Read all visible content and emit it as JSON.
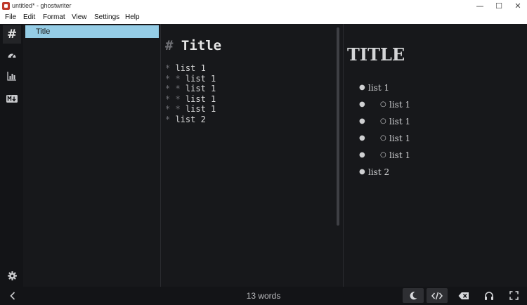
{
  "window": {
    "title": "untitled* - ghostwriter",
    "controls": {
      "minimize": "—",
      "maximize": "☐",
      "close": "✕"
    }
  },
  "menu": [
    "File",
    "Edit",
    "Format",
    "View",
    "Settings",
    "Help"
  ],
  "sidebar": {
    "icons": [
      "hash-icon",
      "speedometer-icon",
      "bar-chart-icon",
      "markdown-icon"
    ],
    "settings_icon": "gear-icon",
    "hash_glyph": "#"
  },
  "outline": {
    "items": [
      "Title"
    ]
  },
  "editor": {
    "heading_mark": "#",
    "heading_text": "Title",
    "lines": [
      {
        "marks": "* ",
        "text": "list 1"
      },
      {
        "marks": "* * ",
        "text": "list 1"
      },
      {
        "marks": "* * ",
        "text": "list 1"
      },
      {
        "marks": "* * ",
        "text": "list 1"
      },
      {
        "marks": "* * ",
        "text": "list 1"
      },
      {
        "marks": "* ",
        "text": "list 2"
      }
    ]
  },
  "preview": {
    "title": "TITLE",
    "items": [
      {
        "text": "list 1",
        "level": 1
      },
      {
        "text": "list 1",
        "level": 2
      },
      {
        "text": "list 1",
        "level": 2
      },
      {
        "text": "list 1",
        "level": 2
      },
      {
        "text": "list 1",
        "level": 2
      },
      {
        "text": "list 2",
        "level": 1
      }
    ]
  },
  "statusbar": {
    "word_count": "13 words",
    "buttons": [
      "dark-mode-icon",
      "code-view-icon",
      "delete-back-icon",
      "headphones-icon",
      "fullscreen-icon"
    ]
  },
  "colors": {
    "background": "#17181b",
    "outline_highlight": "#95cde6",
    "app_icon": "#c0392b"
  }
}
